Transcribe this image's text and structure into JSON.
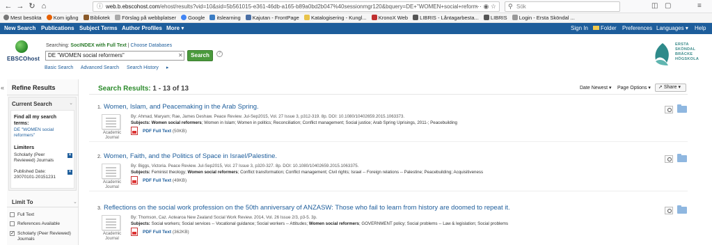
{
  "browser": {
    "url_host": "web.b.ebscohost.com",
    "url_rest": "/ehost/results?vid=10&sid=5b561015-e361-46db-a165-b89a0bd2b047%40sessionmgr120&bquery=DE+\"WOMEN+social+reform",
    "search_placeholder": "Sök",
    "bookmarks": [
      "Mest besökta",
      "Kom igång",
      "Bibliotek",
      "Förslag på webbplatser",
      "Google",
      "itslearning",
      "Kajutan - FrontPage",
      "Katalogisering - Kungl...",
      "KronoX Web",
      "LIBRIS - Låntagarbesta...",
      "LIBRIS",
      "Login - Ersta Sköndal ..."
    ]
  },
  "topnav": {
    "items": [
      "New Search",
      "Publications",
      "Subject Terms",
      "Author Profiles",
      "More"
    ],
    "right": [
      "Sign In",
      "Folder",
      "Preferences",
      "Languages",
      "Help"
    ]
  },
  "search": {
    "searching_label": "Searching:",
    "database": "SocINDEX with Full Text",
    "choose_db": "Choose Databases",
    "query": "DE \"WOMEN social reformers\"",
    "button": "Search",
    "links": [
      "Basic Search",
      "Advanced Search",
      "Search History"
    ]
  },
  "logo": {
    "text": "EBSCOhost"
  },
  "org_logo": {
    "lines": [
      "ERSTA",
      "SKÖNDAL",
      "BRÄCKE",
      "HÖGSKOLA"
    ]
  },
  "refine": {
    "title": "Refine Results",
    "current_search": "Current Search",
    "find_all": "Find all my search terms:",
    "term": "DE \"WOMEN social reformers\"",
    "limiters_heading": "Limiters",
    "limiters": [
      "Scholarly (Peer Reviewed) Journals",
      "Published Date: 20070101-20151231"
    ],
    "limit_to": "Limit To",
    "limit_options": [
      {
        "label": "Full Text",
        "checked": false
      },
      {
        "label": "References Available",
        "checked": false
      },
      {
        "label": "Scholarly (Peer Reviewed) Journals",
        "checked": true
      }
    ]
  },
  "results": {
    "heading": "Search Results:",
    "range": "1 - 13 of 13",
    "sort": "Date Newest",
    "page_options": "Page Options",
    "share": "Share",
    "records": [
      {
        "num": "1.",
        "title": "Women, Islam, and Peacemaking in the Arab Spring.",
        "meta": "By: Ahmad, Maryam; Rae, James Deshaw. Peace Review. Jul-Sep2015, Vol. 27 Issue 3, p312-319. 8p. DOI: 10.1080/10402659.2015.1063373.",
        "subjects_label": "Subjects:",
        "subjects_bold": "Women social reformers",
        "subjects_rest": "; Women in Islam; Women in politics; Reconciliation; Conflict management; Social justice; Arab Spring Uprisings, 2011-; Peacebuilding",
        "doc_type": "Academic Journal",
        "pdf_label": "PDF Full Text",
        "pdf_size": "(50KB)"
      },
      {
        "num": "2.",
        "title": "Women, Faith, and the Politics of Space in Israel/Palestine.",
        "meta": "By: Biggs, Victoria. Peace Review. Jul-Sep2015, Vol. 27 Issue 3, p320-327. 8p. DOI: 10.1080/10402659.2015.1063375.",
        "subjects_label": "Subjects:",
        "subjects_pre": " Feminist theology; ",
        "subjects_bold": "Women social reformers",
        "subjects_rest": "; Conflict transformation; Conflict management; Civil rights; Israel -- Foreign relations -- Palestine; Peacebuilding; Acquisitiveness",
        "doc_type": "Academic Journal",
        "pdf_label": "PDF Full Text",
        "pdf_size": "(49KB)"
      },
      {
        "num": "3.",
        "title": "Reflections on the social work profession on the 50th anniversary of ANZASW: Those who fail to learn from history are doomed to repeat it.",
        "meta": "By: Thomson, Caz. Aotearoa New Zealand Social Work Review. 2014, Vol. 26 Issue 2/3, p3-5. 3p.",
        "subjects_label": "Subjects:",
        "subjects_pre": " Social workers; Social services -- Vocational guidance; Social workers -- Attitudes; ",
        "subjects_bold": "Women social reformers",
        "subjects_rest": "; GOVERNMENT policy; Social problems -- Law & legislation; Social problems",
        "doc_type": "Academic Journal",
        "pdf_label": "PDF Full Text",
        "pdf_size": "(362KB)"
      }
    ]
  },
  "colors": {
    "nav": "#1d5d9b",
    "accent_green": "#2a8a2a",
    "link": "#1d5d9b"
  }
}
